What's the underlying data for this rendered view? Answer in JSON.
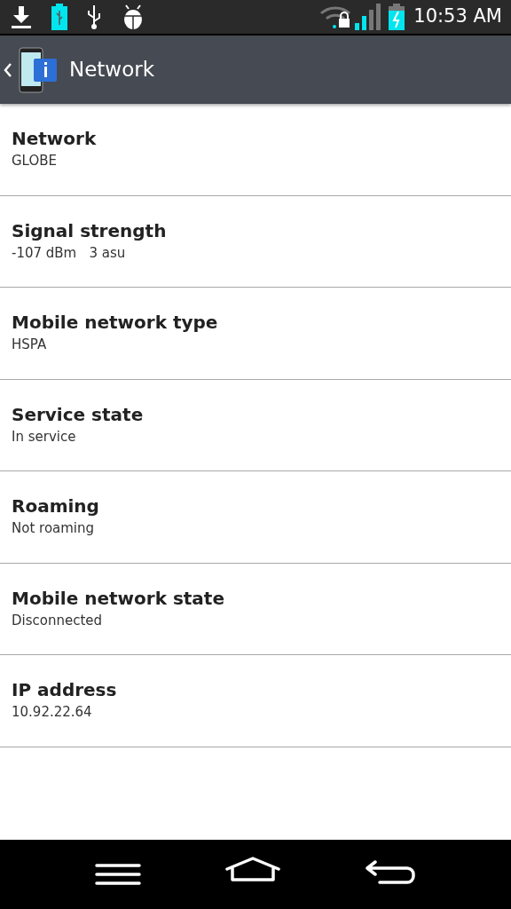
{
  "status_bar": {
    "time": "10:53 AM"
  },
  "title_bar": {
    "title": "Network"
  },
  "items": [
    {
      "title": "Network",
      "value": "GLOBE"
    },
    {
      "title": "Signal strength",
      "value": "-107 dBm   3 asu"
    },
    {
      "title": "Mobile network type",
      "value": "HSPA"
    },
    {
      "title": "Service state",
      "value": "In service"
    },
    {
      "title": "Roaming",
      "value": "Not roaming"
    },
    {
      "title": "Mobile network state",
      "value": "Disconnected"
    },
    {
      "title": "IP address",
      "value": "10.92.22.64"
    }
  ]
}
